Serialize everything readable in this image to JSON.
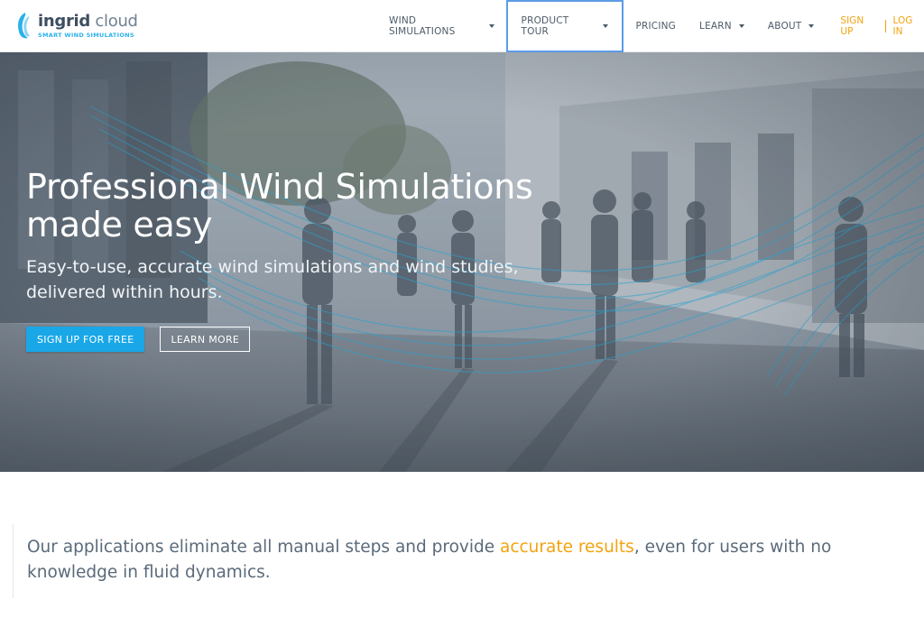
{
  "brand": {
    "name_bold": "ingrid",
    "name_light": " cloud",
    "tagline": "SMART WIND SIMULATIONS",
    "accent_color": "#19a7e8"
  },
  "nav": {
    "items": [
      {
        "label": "WIND SIMULATIONS",
        "dropdown": true,
        "icon": "chevron-down-icon"
      },
      {
        "label": "PRODUCT TOUR",
        "dropdown": true,
        "icon": "chevron-down-icon",
        "focused": true
      },
      {
        "label": "PRICING",
        "dropdown": false
      },
      {
        "label": "LEARN",
        "dropdown": true,
        "icon": "chevron-down-icon"
      },
      {
        "label": "ABOUT",
        "dropdown": true,
        "icon": "chevron-down-icon"
      }
    ],
    "sign_up": "SIGN UP",
    "log_in": "LOG IN",
    "auth_color": "#f2a30f"
  },
  "hero": {
    "title_line1": "Professional Wind Simulations",
    "title_line2": "made easy",
    "subtitle_line1": "Easy-to-use, accurate wind simulations and wind studies,",
    "subtitle_line2": "delivered within hours.",
    "cta_primary": "SIGN UP FOR FREE",
    "cta_secondary": "LEARN MORE"
  },
  "intro": {
    "text_before": "Our applications eliminate all manual steps and provide ",
    "highlight": "accurate results",
    "text_after": ", even for users with no knowledge in fluid dynamics."
  }
}
